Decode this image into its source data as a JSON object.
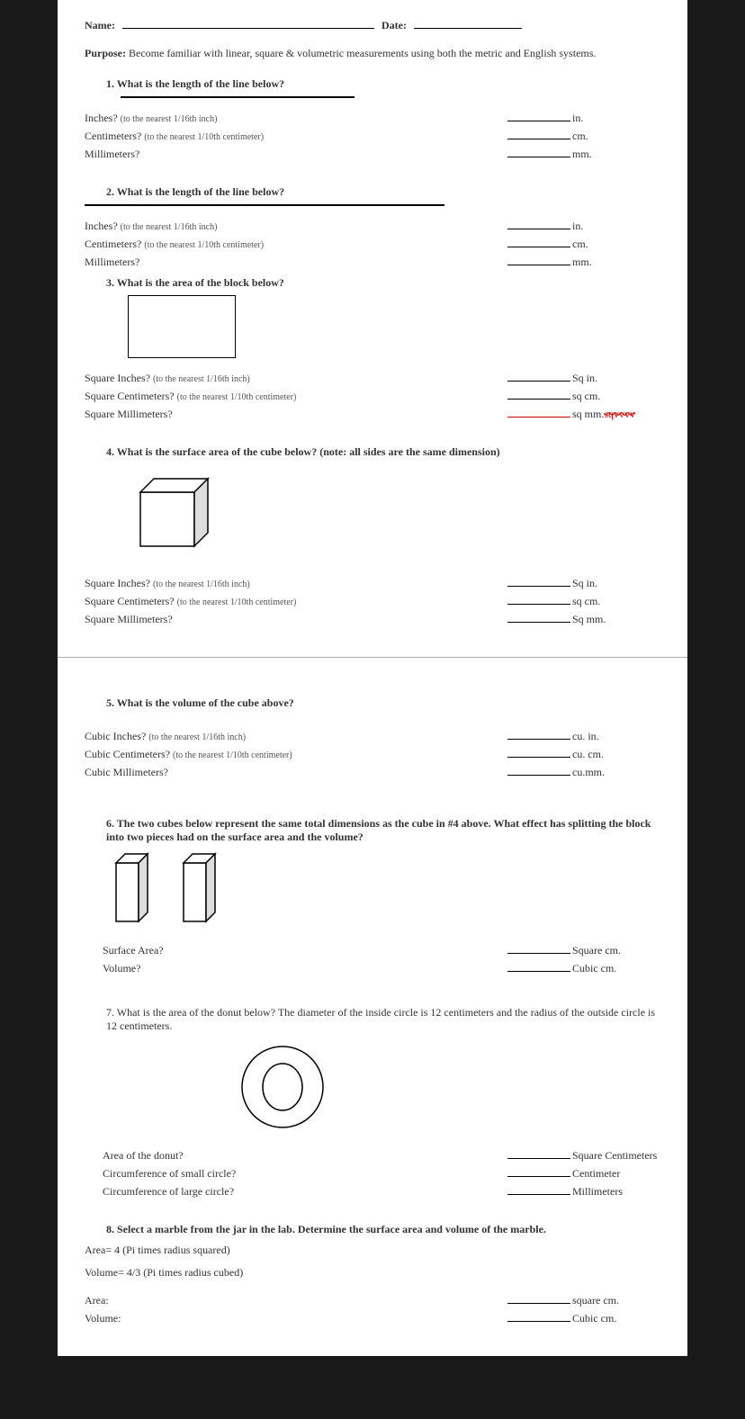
{
  "header": {
    "name_label": "Name:",
    "date_label": "Date:"
  },
  "purpose": {
    "label": "Purpose:",
    "text": "Become familiar with linear, square & volumetric measurements using both the metric and English systems."
  },
  "q1": {
    "title": "1.   What is the length of the line below?",
    "inches": "Inches?",
    "inches_note": "(to the nearest 1/16th inch)",
    "cm": "Centimeters?",
    "cm_note": "(to the nearest 1/10th centimeter)",
    "mm": "Millimeters?",
    "u_in": "in.",
    "u_cm": "cm.",
    "u_mm": "mm."
  },
  "q2": {
    "title": "2.   What is the length of the line below?",
    "inches": "Inches?",
    "inches_note": "(to the nearest 1/16th inch)",
    "cm": "Centimeters?",
    "cm_note": "(to the nearest 1/10th centimeter)",
    "mm": "Millimeters?",
    "u_in": "in.",
    "u_cm": "cm.",
    "u_mm": "mm."
  },
  "q3": {
    "title": "3.   What is the area of the block below?",
    "sq_in": "Square Inches?",
    "sq_in_note": "(to the nearest 1/16th inch)",
    "sq_cm": "Square Centimeters?",
    "sq_cm_note": "(to the nearest 1/10th centimeter)",
    "sq_mm": "Square Millimeters?",
    "u_sqin": "Sq in.",
    "u_sqcm": "sq cm.",
    "u_sqmm": "sq mm.",
    "u_sqmm_strike": "sqvvvv"
  },
  "q4": {
    "title": "4.   What is the surface area of the cube below?   (note:  all sides are the same dimension)",
    "sq_in": "Square Inches?",
    "sq_in_note": "(to the nearest 1/16th inch)",
    "sq_cm": "Square Centimeters?",
    "sq_cm_note": "(to the nearest 1/10th centimeter)",
    "sq_mm": "Square Millimeters?",
    "u_sqin": "Sq in.",
    "u_sqcm": "sq cm.",
    "u_sqmm": "Sq mm."
  },
  "q5": {
    "title": "5.   What is the volume of the cube above?",
    "cu_in": "Cubic Inches?",
    "cu_in_note": "(to the nearest 1/16th inch)",
    "cu_cm": "Cubic Centimeters?",
    "cu_cm_note": "(to the nearest 1/10th centimeter)",
    "cu_mm": "Cubic Millimeters?",
    "u_cin": "cu. in.",
    "u_ccm": "cu. cm.",
    "u_cmm": "cu.mm."
  },
  "q6": {
    "title": "6.   The two cubes below represent the same total dimensions as the cube in #4 above.  What effect has splitting the block into two pieces had on the surface area and the volume?",
    "sa": "Surface Area?",
    "vol": "Volume?",
    "u_sqcm": "Square cm.",
    "u_ccm": "Cubic cm."
  },
  "q7": {
    "title": "7.   What is the area of the donut below?  The diameter of the inside circle is 12 centimeters and the radius of the outside circle is 12 centimeters.",
    "area": "Area of the donut?",
    "circ_small": "Circumference of small circle?",
    "circ_large": "Circumference of large circle?",
    "u_sqcm": "Square Centimeters",
    "u_cm": "Centimeter",
    "u_mm": "Millimeters"
  },
  "q8": {
    "title": "8.   Select a marble from the jar in the lab.   Determine the surface area and volume of the marble.",
    "formula1": "Area= 4 (Pi times radius squared)",
    "formula2": "Volume= 4/3 (Pi times radius cubed)",
    "area": "Area:",
    "vol": "Volume:",
    "u_sqcm": "square cm.",
    "u_ccm": "Cubic cm."
  }
}
